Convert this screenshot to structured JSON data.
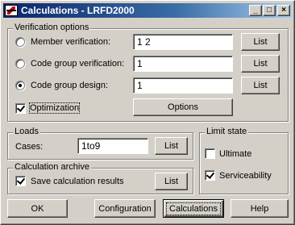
{
  "window": {
    "title": "Calculations - LRFD2000",
    "minimize": "_",
    "maximize": "□",
    "close": "×"
  },
  "verification": {
    "title": "Verification options",
    "member_label": "Member verification:",
    "member_value": "1 2",
    "code_group_verif_label": "Code group verification:",
    "code_group_verif_value": "1",
    "code_group_design_label": "Code group design:",
    "code_group_design_value": "1",
    "list_label": "List",
    "optimization_label": "Optimization",
    "options_label": "Options",
    "selected_mode": "code_group_design",
    "optimization_checked": true
  },
  "loads": {
    "title": "Loads",
    "cases_label": "Cases:",
    "cases_value": "1to9",
    "list_label": "List"
  },
  "archive": {
    "title": "Calculation archive",
    "save_label": "Save calculation results",
    "save_checked": true,
    "list_label": "List"
  },
  "limit_state": {
    "title": "Limit state",
    "ultimate_label": "Ultimate",
    "ultimate_checked": false,
    "serviceability_label": "Serviceability",
    "serviceability_checked": true
  },
  "buttons": {
    "ok": "OK",
    "configuration": "Configuration",
    "calculations": "Calculations",
    "help": "Help"
  },
  "colors": {
    "title_start": "#0a246a",
    "title_end": "#a6caf0",
    "face": "#d4d0c8"
  }
}
